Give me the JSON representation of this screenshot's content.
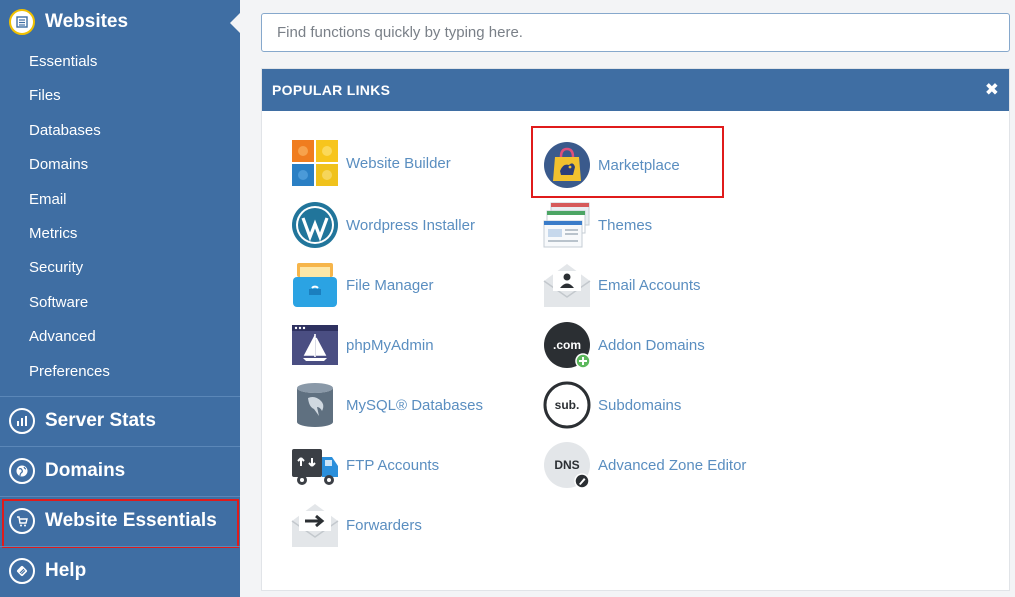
{
  "sidebar": {
    "websites": {
      "title": "Websites",
      "items": [
        "Essentials",
        "Files",
        "Databases",
        "Domains",
        "Email",
        "Metrics",
        "Security",
        "Software",
        "Advanced",
        "Preferences"
      ]
    },
    "server_stats": "Server Stats",
    "domains": "Domains",
    "website_essentials": "Website Essentials",
    "help": "Help"
  },
  "search": {
    "placeholder": "Find functions quickly by typing here."
  },
  "panel": {
    "title": "POPULAR LINKS",
    "close_glyph": "✖",
    "links_left": [
      "Website Builder",
      "Wordpress Installer",
      "File Manager",
      "phpMyAdmin",
      "MySQL® Databases",
      "FTP Accounts",
      "Forwarders"
    ],
    "links_right": [
      "Marketplace",
      "Themes",
      "Email Accounts",
      "Addon Domains",
      "Subdomains",
      "Advanced Zone Editor"
    ],
    "icon_text": {
      "com": ".com",
      "sub": "sub.",
      "dns": "DNS"
    }
  },
  "colors": {
    "sidebar_bg": "#3f6ea3",
    "link_text": "#5a8ec0",
    "highlight": "#e01b1b"
  }
}
